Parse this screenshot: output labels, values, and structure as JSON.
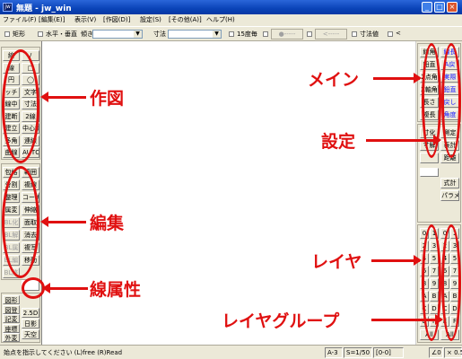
{
  "window": {
    "app_icon": "jw",
    "title": "無題 - jw_win"
  },
  "menu": [
    "ファイル(F)",
    "[編集(E)]",
    "表示(V)",
    "[作図(D)]",
    "設定(S)",
    "[その他(A)]",
    "ヘルプ(H)"
  ],
  "options": {
    "rect": "矩形",
    "horiz_vert": "水平・垂直",
    "tilt": "傾き",
    "dim": "寸法",
    "deg15": "15度毎",
    "btn1": "●-----",
    "btn2": "<-----",
    "dim_value": "寸法値",
    "lt": "<"
  },
  "left_panel": {
    "draw": [
      "/",
      "□",
      "◯",
      "文字",
      "寸法",
      "2線",
      "中心線",
      "連線",
      "AUTO"
    ],
    "draw_partial": [
      "線",
      "線",
      "円",
      "ッチ",
      "線中",
      "建断",
      "建立",
      "多角",
      "曲線"
    ],
    "edit": [
      "範囲",
      "複線",
      "コーナー",
      "伸縮",
      "面取",
      "消去",
      "複写",
      "移動"
    ],
    "edit_partial": [
      "包絡",
      "分割",
      "整理",
      "属変",
      "BL化",
      "BL解",
      "BL属",
      "BL編",
      "BL終"
    ],
    "lower": [
      "図形",
      "図登",
      "記変",
      "座標",
      "外変",
      "2.5D",
      "日影",
      "天空"
    ]
  },
  "right_panel": {
    "main": [
      "線角",
      "鉛直",
      "2点角",
      "X軸角",
      "長さ",
      "複長"
    ],
    "settings": [
      "線長",
      "A戻",
      "実際",
      "鉛直",
      "戻し",
      "角度"
    ],
    "tools": [
      "寸化",
      "寸解",
      "測定",
      "表計",
      "距離",
      "式計",
      "パラメ"
    ],
    "layer_numbers": [
      "0",
      "1",
      "2",
      "3",
      "4",
      "5",
      "6",
      "7",
      "8",
      "9",
      "A",
      "B",
      "C",
      "D",
      "E",
      "F"
    ],
    "layer_all": "All"
  },
  "status": {
    "message": "始点を指示してください (L)free (R)Read",
    "paper": "A-3",
    "scale": "S=1/50",
    "layer": "[0-0]",
    "angle": "∠0",
    "zoom": "× 0.5"
  },
  "annotations": {
    "draw": "作図",
    "edit": "編集",
    "line_attr": "線属性",
    "main": "メイン",
    "settings": "設定",
    "layer": "レイヤ",
    "layer_group": "レイヤグループ"
  },
  "colors": {
    "annotation": "#e01010",
    "titlebar": "#0a43b8",
    "face": "#ece9d8"
  }
}
